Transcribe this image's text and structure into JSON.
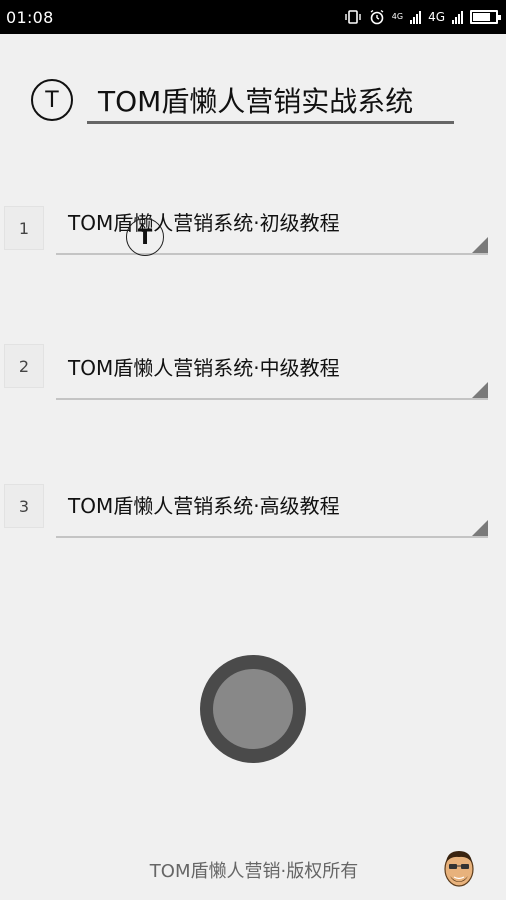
{
  "status_bar": {
    "time": "01:08",
    "network_small": "4G",
    "network": "4G"
  },
  "header": {
    "logo_letter": "T",
    "title": "TOM盾懒人营销实战系统"
  },
  "items": [
    {
      "number": "1",
      "label": "TOM盾懒人营销系统·初级教程"
    },
    {
      "number": "2",
      "label": "TOM盾懒人营销系统·中级教程"
    },
    {
      "number": "3",
      "label": "TOM盾懒人营销系统·高级教程"
    }
  ],
  "overlay": {
    "letter": "T"
  },
  "footer": {
    "copyright": "TOM盾懒人营销·版权所有"
  },
  "status_icons": [
    "vibrate-icon",
    "alarm-icon",
    "signal-icon",
    "battery-icon"
  ],
  "battery_level": 0.75,
  "colors": {
    "background": "#f0f0f0",
    "status_bar": "#000000",
    "round_button_outer": "#4a4a4a",
    "round_button_inner": "#888888"
  }
}
